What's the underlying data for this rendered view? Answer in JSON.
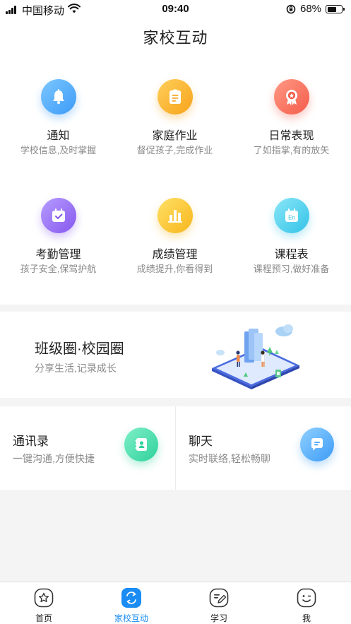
{
  "status_bar": {
    "carrier": "中国移动",
    "time": "09:40",
    "battery": "68%",
    "battery_level": 0.68
  },
  "header": {
    "title": "家校互动"
  },
  "features": [
    {
      "title": "通知",
      "subtitle": "学校信息,及时掌握",
      "icon": "bell-icon",
      "color_from": "#7cc7ff",
      "color_to": "#3d9bf7"
    },
    {
      "title": "家庭作业",
      "subtitle": "督促孩子,完成作业",
      "icon": "homework-icon",
      "color_from": "#ffcf5a",
      "color_to": "#f7a31c"
    },
    {
      "title": "日常表现",
      "subtitle": "了如指掌,有的放矢",
      "icon": "medal-icon",
      "color_from": "#ff9a85",
      "color_to": "#f45b4a"
    },
    {
      "title": "考勤管理",
      "subtitle": "孩子安全,保驾护航",
      "icon": "calendar-check-icon",
      "color_from": "#b69cff",
      "color_to": "#8657ee"
    },
    {
      "title": "成绩管理",
      "subtitle": "成绩提升,你看得到",
      "icon": "bar-chart-icon",
      "color_from": "#ffe066",
      "color_to": "#f7b61c"
    },
    {
      "title": "课程表",
      "subtitle": "课程预习,做好准备",
      "icon": "calendar-en-icon",
      "color_from": "#8ae6f7",
      "color_to": "#33c3e8"
    }
  ],
  "class_circle": {
    "title": "班级圈·校园圈",
    "subtitle": "分享生活,记录成长",
    "illustration": "phone-community-illustration"
  },
  "contacts": [
    {
      "title": "通讯录",
      "subtitle": "一键沟通,方便快捷",
      "icon": "address-book-icon",
      "color_from": "#7ff0c8",
      "color_to": "#2fd19c"
    },
    {
      "title": "聊天",
      "subtitle": "实时联络,轻松畅聊",
      "icon": "chat-bubble-icon",
      "color_from": "#8fd0ff",
      "color_to": "#3d9bf7"
    }
  ],
  "tabs": [
    {
      "label": "首页",
      "icon": "star-icon",
      "active": false
    },
    {
      "label": "家校互动",
      "icon": "interaction-icon",
      "active": true
    },
    {
      "label": "学习",
      "icon": "edit-icon",
      "active": false
    },
    {
      "label": "我",
      "icon": "smile-icon",
      "active": false
    }
  ],
  "colors": {
    "accent": "#1a8cf3",
    "background": "#f4f4f4",
    "subtitle_text": "#8a8a8a"
  }
}
